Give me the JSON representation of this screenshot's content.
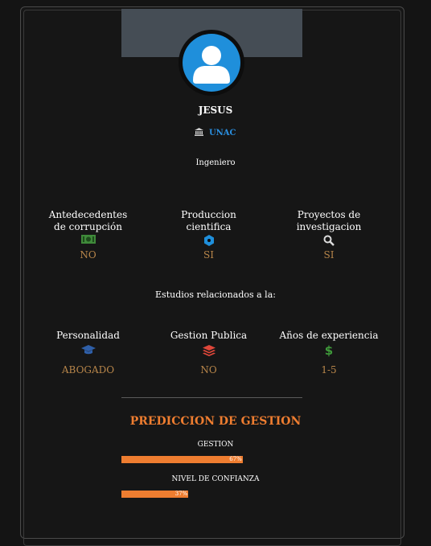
{
  "profile": {
    "name": "JESUS",
    "institution": "UNAC",
    "role": "Ingeniero"
  },
  "indicators": [
    {
      "label": "Antedecedentes de corrupción",
      "icon": "money-icon",
      "value": "NO"
    },
    {
      "label": "Produccion cientifica",
      "icon": "atom-icon",
      "value": "SI"
    },
    {
      "label": "Proyectos de investigacion",
      "icon": "search-icon",
      "value": "SI"
    }
  ],
  "studies_heading": "Estudios relacionados a la:",
  "studies": [
    {
      "label": "Personalidad",
      "icon": "graduation-cap-icon",
      "value": "ABOGADO"
    },
    {
      "label": "Gestion Publica",
      "icon": "layers-icon",
      "value": "NO"
    },
    {
      "label": "Años de experiencia",
      "icon": "dollar-icon",
      "value": "1-5"
    }
  ],
  "prediction": {
    "title": "PREDICCION DE GESTION",
    "bars": [
      {
        "label": "GESTION",
        "percent": 67,
        "percent_label": "67%"
      },
      {
        "label": "NIVEL DE CONFIANZA",
        "percent": 37,
        "percent_label": "37%"
      }
    ]
  },
  "colors": {
    "accent": "#ee7d30",
    "value": "#b8864a",
    "link": "#2a8fe0",
    "avatar": "#1f8fdb"
  }
}
